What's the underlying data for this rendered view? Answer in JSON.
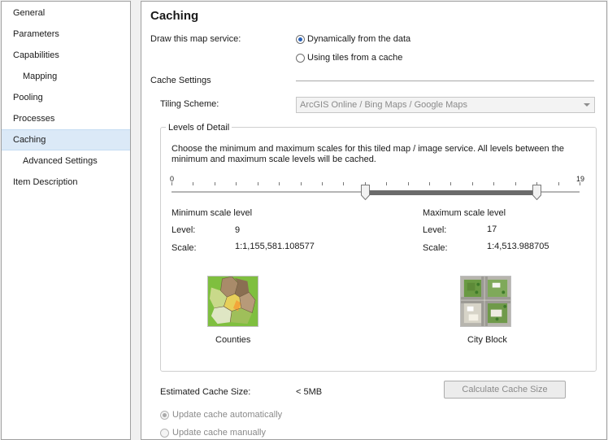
{
  "sidebar": {
    "items": [
      {
        "label": "General"
      },
      {
        "label": "Parameters"
      },
      {
        "label": "Capabilities"
      },
      {
        "label": "Mapping"
      },
      {
        "label": "Pooling"
      },
      {
        "label": "Processes"
      },
      {
        "label": "Caching"
      },
      {
        "label": "Advanced Settings"
      },
      {
        "label": "Item Description"
      }
    ],
    "selected": "Caching"
  },
  "main": {
    "title": "Caching",
    "draw_label": "Draw this map service:",
    "draw_options": [
      "Dynamically from the data",
      "Using tiles from a cache"
    ],
    "draw_selected": "Dynamically from the data",
    "cache_settings_label": "Cache Settings",
    "tiling_scheme_label": "Tiling Scheme:",
    "tiling_scheme_value": "ArcGIS Online / Bing Maps / Google Maps",
    "lod": {
      "group_title": "Levels of Detail",
      "description": "Choose the minimum and maximum scales for this tiled map / image service. All levels between the minimum and maximum scale levels will be cached.",
      "min_tick": "0",
      "max_tick": "19",
      "min_level": 9,
      "max_level": 17,
      "min": {
        "heading": "Minimum scale level",
        "level_label": "Level:",
        "level_value": "9",
        "scale_label": "Scale:",
        "scale_value": "1:1,155,581.108577",
        "preview_caption": "Counties"
      },
      "max": {
        "heading": "Maximum scale level",
        "level_label": "Level:",
        "level_value": "17",
        "scale_label": "Scale:",
        "scale_value": "1:4,513.988705",
        "preview_caption": "City Block"
      }
    },
    "cache_size_label": "Estimated Cache Size:",
    "cache_size_value": "< 5MB",
    "calculate_button": "Calculate Cache Size",
    "update_options": [
      "Update cache automatically",
      "Update cache manually"
    ],
    "update_selected": "Update cache automatically",
    "colors": {
      "selection": "#dbe9f7",
      "range": "#6b6b6b",
      "radio_accent": "#2a62b8"
    }
  }
}
